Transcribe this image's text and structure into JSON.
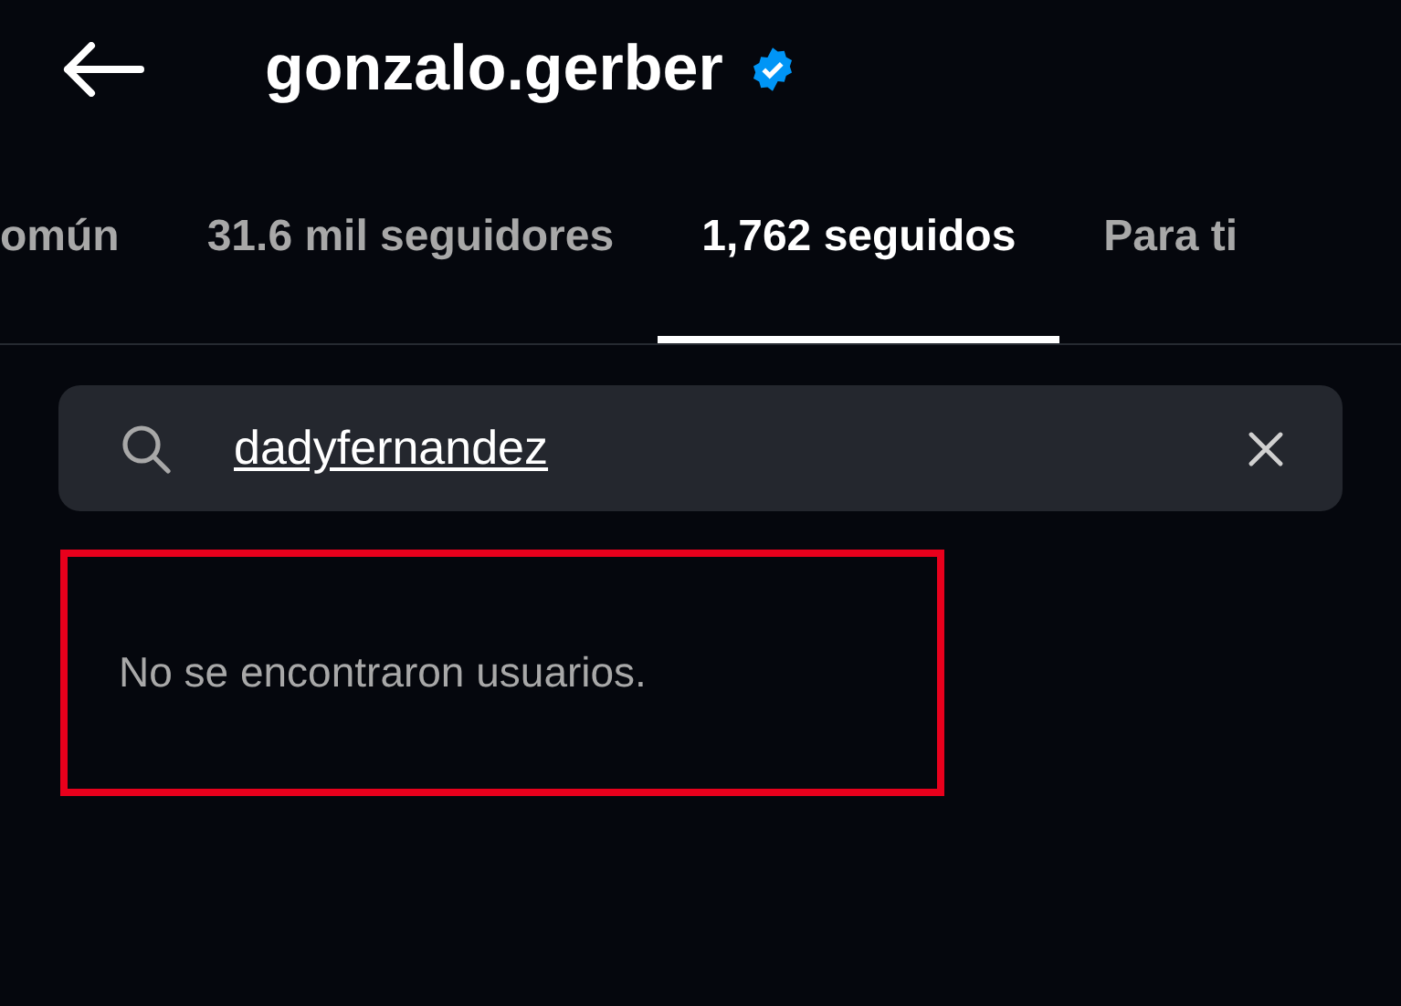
{
  "header": {
    "title": "gonzalo.gerber",
    "verified": true
  },
  "tabs": [
    {
      "label": "omún",
      "selected": false
    },
    {
      "label": "31.6 mil seguidores",
      "selected": false
    },
    {
      "label": "1,762 seguidos",
      "selected": true
    },
    {
      "label": "Para ti",
      "selected": false
    }
  ],
  "search": {
    "value": "dadyfernandez"
  },
  "results": {
    "message": "No se encontraron usuarios.",
    "highlighted": true
  }
}
